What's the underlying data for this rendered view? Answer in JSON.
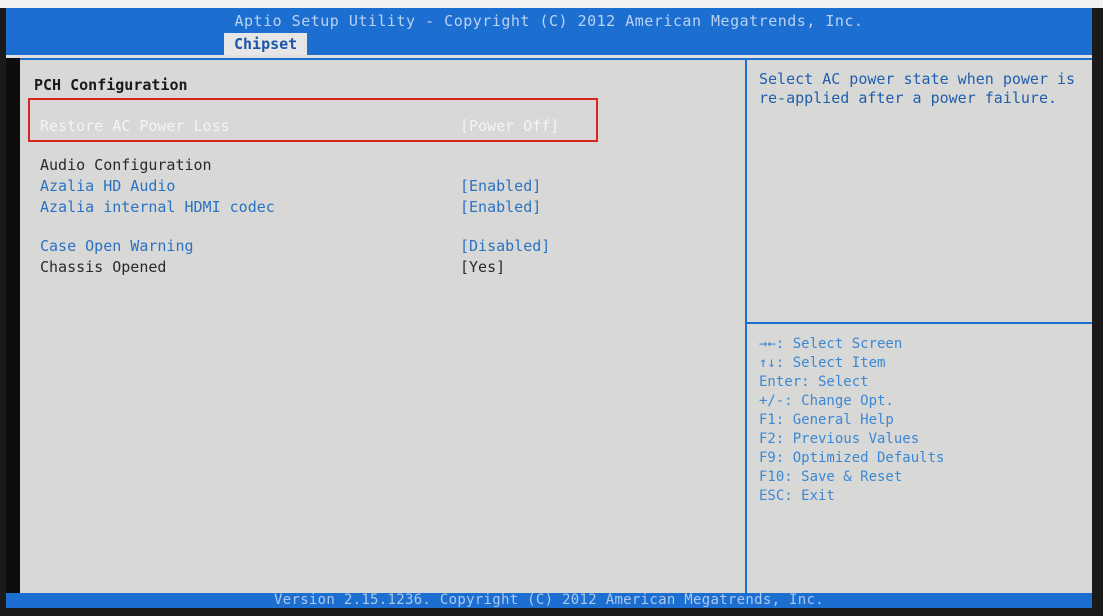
{
  "header": {
    "title": "Aptio Setup Utility - Copyright (C) 2012 American Megatrends, Inc.",
    "active_tab": "Chipset"
  },
  "main": {
    "section_title": "PCH Configuration",
    "restore_ac": {
      "label": "Restore AC Power Loss",
      "value": "[Power Off]"
    },
    "audio_title": "Audio Configuration",
    "azalia_hd": {
      "label": "Azalia HD Audio",
      "value": "[Enabled]"
    },
    "azalia_hdmi": {
      "label": "Azalia internal HDMI codec",
      "value": "[Enabled]"
    },
    "case_open": {
      "label": "Case Open Warning",
      "value": "[Disabled]"
    },
    "chassis": {
      "label": "Chassis Opened",
      "value": "[Yes]"
    }
  },
  "help": {
    "text": "Select AC power state when power is re-applied after a power failure."
  },
  "keys": [
    "→←: Select Screen",
    "↑↓: Select Item",
    "Enter: Select",
    "+/-: Change Opt.",
    "F1: General Help",
    "F2: Previous Values",
    "F9: Optimized Defaults",
    "F10: Save & Reset",
    "ESC: Exit"
  ],
  "footer": {
    "text": "Version 2.15.1236. Copyright (C) 2012 American Megatrends, Inc."
  },
  "colors": {
    "header_blue": "#1c6fd0",
    "panel_bg": "#d8d8d6",
    "selection_box": "#d9261c",
    "link_blue": "#2a72c4"
  }
}
